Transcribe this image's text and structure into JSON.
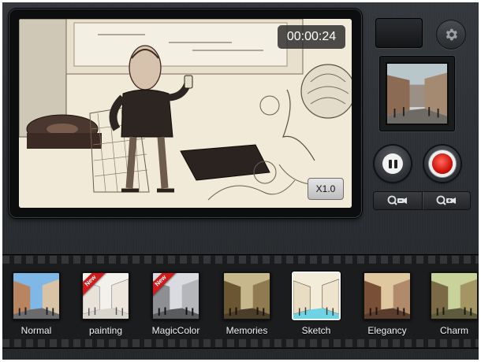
{
  "recorder": {
    "timer": "00:00:24",
    "zoom_level": "X1.0"
  },
  "controls": {
    "settings_icon": "gear-icon",
    "pause_icon": "pause-icon",
    "record_icon": "record-icon",
    "zoom_out_icon": "zoom-out-icon",
    "zoom_in_icon": "zoom-in-icon",
    "record_color": "#d0130a"
  },
  "filters": [
    {
      "label": "Normal",
      "badge": ""
    },
    {
      "label": "painting",
      "badge": "New"
    },
    {
      "label": "MagicColor",
      "badge": "New"
    },
    {
      "label": "Memories",
      "badge": ""
    },
    {
      "label": "Sketch",
      "badge": "",
      "selected": true
    },
    {
      "label": "Elegancy",
      "badge": ""
    },
    {
      "label": "Charm",
      "badge": ""
    }
  ]
}
